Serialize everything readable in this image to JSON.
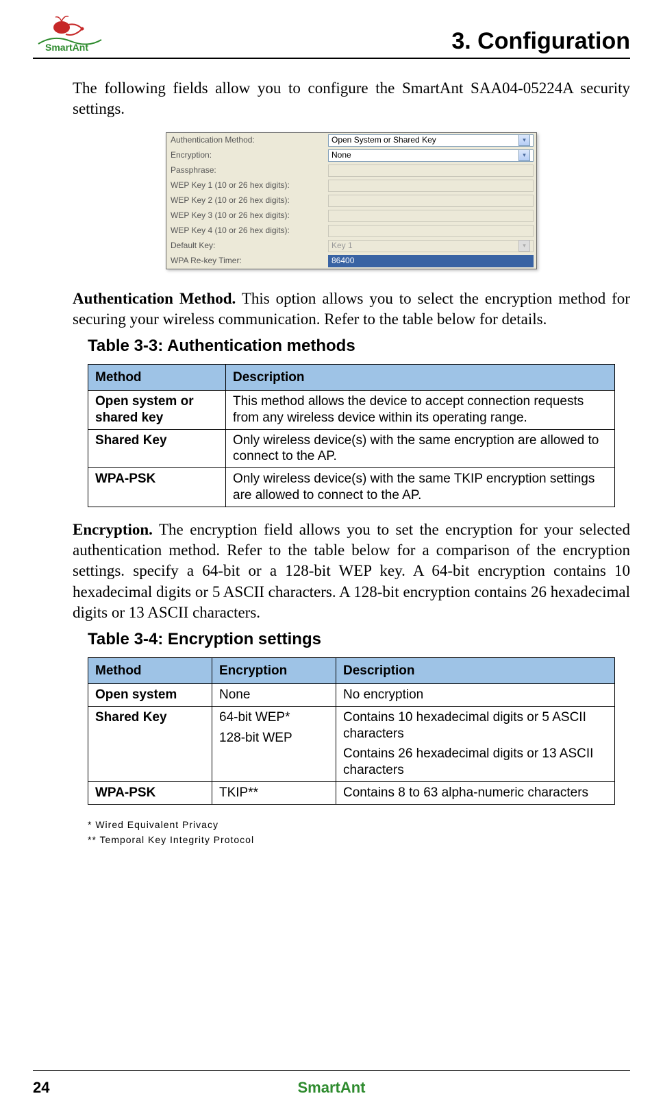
{
  "header": {
    "logo_text": "SmartAnt",
    "chapter_title": "3. Configuration"
  },
  "intro": "The following fields allow you to configure the SmartAnt SAA04-05224A security settings.",
  "screenshot": {
    "rows": [
      {
        "label": "Authentication Method:",
        "value": "Open System or Shared Key",
        "type": "dropdown",
        "enabled": true
      },
      {
        "label": "Encryption:",
        "value": "None",
        "type": "dropdown",
        "enabled": true
      },
      {
        "label": "Passphrase:",
        "value": "",
        "type": "text",
        "enabled": false
      },
      {
        "label": "WEP Key 1 (10 or 26 hex digits):",
        "value": "",
        "type": "text",
        "enabled": false
      },
      {
        "label": "WEP Key 2 (10 or 26 hex digits):",
        "value": "",
        "type": "text",
        "enabled": false
      },
      {
        "label": "WEP Key 3 (10 or 26 hex digits):",
        "value": "",
        "type": "text",
        "enabled": false
      },
      {
        "label": "WEP Key 4 (10 or 26 hex digits):",
        "value": "",
        "type": "text",
        "enabled": false
      },
      {
        "label": "Default Key:",
        "value": "Key 1",
        "type": "dropdown",
        "enabled": false
      },
      {
        "label": "WPA Re-key Timer:",
        "value": "86400",
        "type": "text",
        "enabled": true,
        "highlight": true
      }
    ]
  },
  "auth_para_bold": "Authentication Method.",
  "auth_para_rest": " This option allows you to select the encryption method for securing your wireless communication. Refer to the table below for details.",
  "table3_3": {
    "title": "Table 3-3: Authentication methods",
    "headers": [
      "Method",
      "Description"
    ],
    "rows": [
      {
        "method": "Open system or shared key",
        "desc": "This method allows the device to accept connection requests from any wireless device within its operating range."
      },
      {
        "method": "Shared Key",
        "desc": "Only wireless device(s) with the same encryption are allowed to connect to the AP."
      },
      {
        "method": "WPA-PSK",
        "desc": "Only wireless device(s) with the same TKIP encryption settings are allowed to connect to the AP."
      }
    ]
  },
  "enc_para_bold": "Encryption.",
  "enc_para_rest": " The encryption field allows you to set the encryption for your selected authentication method. Refer to the table below for a comparison of the encryption settings. specify a 64-bit or a 128-bit WEP key. A 64-bit encryption contains 10 hexadecimal digits or 5 ASCII characters. A 128-bit encryption contains 26 hexadecimal digits or 13 ASCII characters.",
  "table3_4": {
    "title": "Table 3-4: Encryption settings",
    "headers": [
      "Method",
      "Encryption",
      "Description"
    ],
    "rows": [
      {
        "method": "Open system",
        "enc": [
          "None"
        ],
        "desc": [
          "No encryption"
        ]
      },
      {
        "method": "Shared Key",
        "enc": [
          "64-bit WEP*",
          "128-bit WEP"
        ],
        "desc": [
          "Contains 10 hexadecimal digits or 5 ASCII characters",
          "Contains 26 hexadecimal digits or 13 ASCII characters"
        ]
      },
      {
        "method": "WPA-PSK",
        "enc": [
          "TKIP**"
        ],
        "desc": [
          "Contains 8 to 63 alpha-numeric characters"
        ]
      }
    ]
  },
  "footnotes": [
    "*   Wired Equivalent Privacy",
    "** Temporal Key Integrity Protocol"
  ],
  "footer": {
    "page": "24",
    "brand": "SmartAnt"
  }
}
